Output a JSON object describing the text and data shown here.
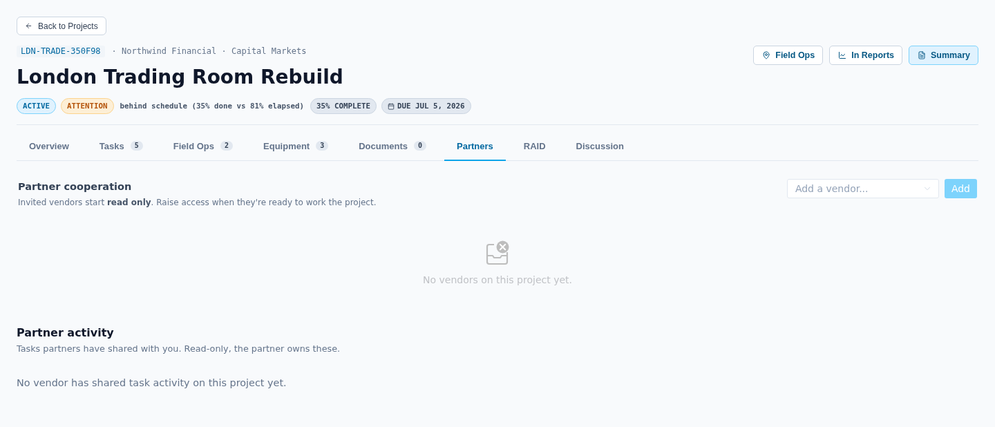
{
  "back_link": {
    "label": "Back to Projects"
  },
  "project": {
    "code": "LDN-TRADE-350F98",
    "context": "· Northwind Financial · Capital Markets",
    "title": "London Trading Room Rebuild"
  },
  "badges": [
    {
      "kind": "status",
      "label": "ACTIVE"
    },
    {
      "kind": "health",
      "label": "ATTENTION"
    },
    {
      "kind": "note",
      "label": "behind schedule (35% done vs 81% elapsed)"
    },
    {
      "kind": "progress",
      "label": "35% COMPLETE"
    },
    {
      "kind": "due",
      "label": "DUE JUL 5, 2026"
    }
  ],
  "actions": [
    {
      "label": "Field Ops",
      "selected": false
    },
    {
      "label": "In Reports",
      "selected": false
    },
    {
      "label": "Summary",
      "selected": true
    }
  ],
  "tabs": [
    {
      "label": "Overview",
      "selected": false
    },
    {
      "label": "Tasks",
      "count": "5",
      "selected": false
    },
    {
      "label": "Field Ops",
      "count": "2",
      "selected": false
    },
    {
      "label": "Equipment",
      "count": "3",
      "selected": false
    },
    {
      "label": "Documents",
      "count": "0",
      "selected": false
    },
    {
      "label": "Partners",
      "selected": true
    },
    {
      "label": "RAID",
      "selected": false
    },
    {
      "label": "Discussion",
      "selected": false
    }
  ],
  "partner_cooperation": {
    "title": "Partner cooperation",
    "description": "Invited vendors start **read only**. Raise access when they're ready to work the project.",
    "vendor_select": {
      "placeholder": "Add a vendor..."
    },
    "add_button": {
      "label": "Add",
      "disabled": true
    },
    "empty_message": "No vendors on this project yet."
  },
  "partner_activity": {
    "title": "Partner activity",
    "description": "Tasks partners have shared with you. Read-only, the partner owns these.",
    "empty_message": "No vendor has shared task activity on this project yet."
  }
}
